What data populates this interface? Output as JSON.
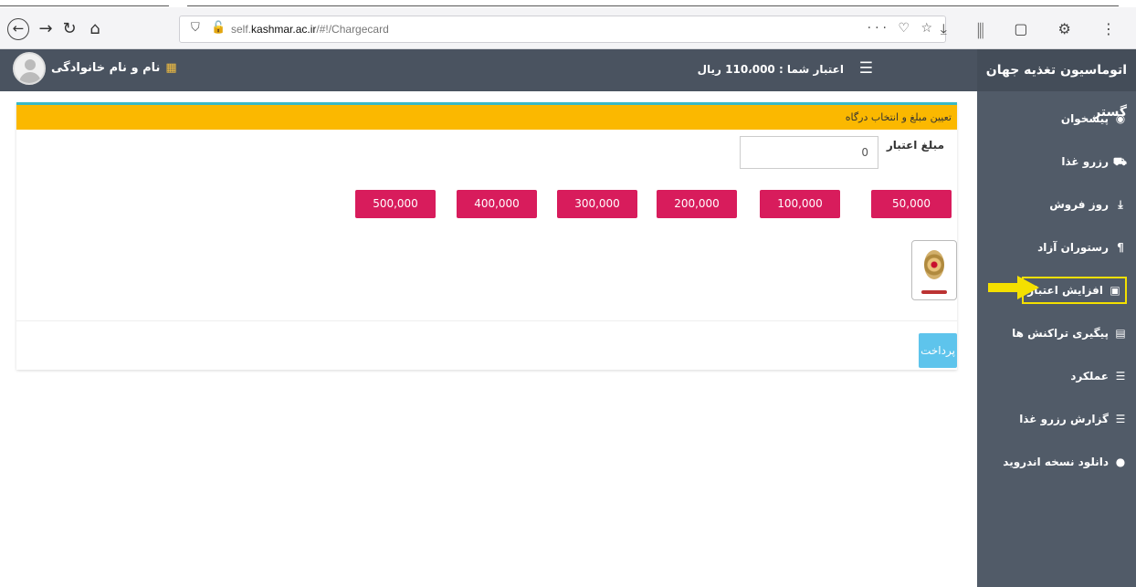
{
  "browser": {
    "url_prefix": "self.",
    "url_domain": "kashmar.ac.ir",
    "url_path": "/#!/Chargecard"
  },
  "header": {
    "user_name": "نام و نام خانوادگی",
    "credit_text": "اعتبار شما : 110،000 ریال"
  },
  "sidebar": {
    "brand": "اتوماسیون تغذیه جهان گستر",
    "items": [
      {
        "label": "پیشخوان",
        "icon": "dashboard-icon"
      },
      {
        "label": "رزرو غذا",
        "icon": "cart-icon"
      },
      {
        "label": "روز فروش",
        "icon": "download-icon"
      },
      {
        "label": "رستوران آزاد",
        "icon": "fork-knife-icon"
      },
      {
        "label": "افزایش اعتبار",
        "icon": "money-icon",
        "highlighted": true
      },
      {
        "label": "پیگیری تراکنش ها",
        "icon": "document-icon"
      },
      {
        "label": "عملکرد",
        "icon": "list-icon"
      },
      {
        "label": "گزارش رزرو غذا",
        "icon": "list-icon"
      },
      {
        "label": "دانلود نسخه اندروید",
        "icon": "android-icon"
      }
    ]
  },
  "card": {
    "title": "تعیین مبلغ و انتخاب درگاه",
    "amount_label": "مبلغ اعتبار",
    "amount_value": "0",
    "amount_buttons": [
      "50,000",
      "100,000",
      "200,000",
      "300,000",
      "400,000",
      "500,000"
    ],
    "pay_label": "پرداخت"
  },
  "colors": {
    "header_bg": "#4a5360",
    "sidebar_bg": "#515b68",
    "card_header": "#fbb800",
    "amount_button": "#d81c5c",
    "pay_button": "#5ec4ec",
    "highlight": "#f4e000"
  }
}
